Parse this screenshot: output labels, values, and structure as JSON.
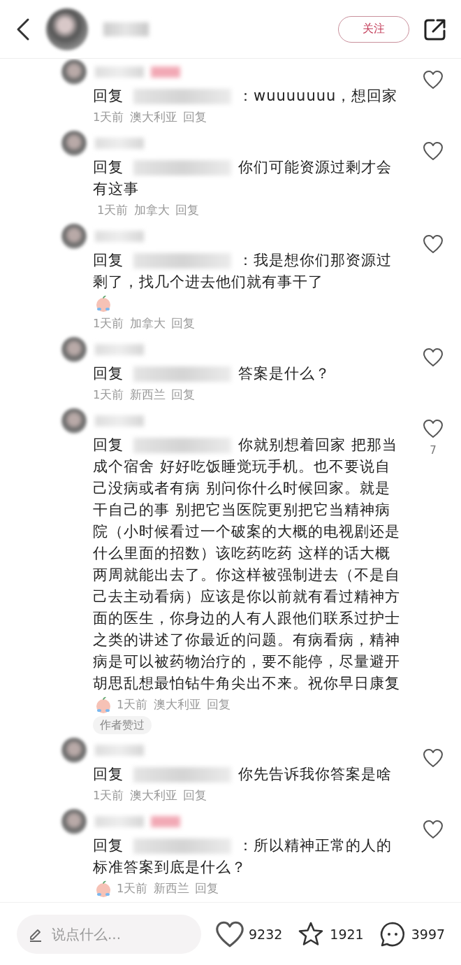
{
  "top_bar": {
    "follow_button": "关注"
  },
  "comments": [
    {
      "tagged": true,
      "reply_label": "回复",
      "text": "：wuuuuuuu，想回家",
      "emoji": false,
      "meta_own_line": true,
      "time": "1天前",
      "location": "澳大利亚",
      "reply": "回复"
    },
    {
      "tagged": false,
      "reply_label": "回复",
      "text": "你们可能资源过剩才会有这事",
      "emoji": false,
      "meta_own_line": false,
      "time": "1天前",
      "location": "加拿大",
      "reply": "回复"
    },
    {
      "tagged": false,
      "reply_label": "回复",
      "text": "：我是想你们那资源过剩了，找几个进去他们就有事干了",
      "emoji": true,
      "meta_own_line": true,
      "time": "1天前",
      "location": "加拿大",
      "reply": "回复"
    },
    {
      "tagged": false,
      "reply_label": "回复",
      "text": "答案是什么？",
      "emoji": false,
      "meta_own_line": true,
      "time": "1天前",
      "location": "新西兰",
      "reply": "回复"
    },
    {
      "tagged": false,
      "reply_label": "回复",
      "text": "你就别想着回家 把那当成个宿舍 好好吃饭睡觉玩手机。也不要说自己没病或者有病 别问你什么时候回家。就是干自己的事 别把它当医院更别把它当精神病院（小时候看过一个破案的大概的电视剧还是什么里面的招数）该吃药吃药 这样的话大概两周就能出去了。你这样被强制进去（不是自己去主动看病）应该是你以前就有看过精神方面的医生，你身边的人有人跟他们联系过护士之类的讲述了你最近的问题。有病看病，精神病是可以被药物治疗的，要不能停，尽量避开胡思乱想最怕钻牛角尖出不来。祝你早日康复",
      "emoji": true,
      "meta_own_line": false,
      "time": "1天前",
      "location": "澳大利亚",
      "reply": "回复",
      "likes": "7",
      "badge": "作者赞过"
    },
    {
      "tagged": false,
      "reply_label": "回复",
      "text": "你先告诉我你答案是啥",
      "emoji": false,
      "meta_own_line": true,
      "time": "1天前",
      "location": "澳大利亚",
      "reply": "回复"
    },
    {
      "tagged": true,
      "reply_label": "回复",
      "text": "：所以精神正常的人的标准答案到底是什么？",
      "emoji": true,
      "meta_own_line": false,
      "time": "1天前",
      "location": "新西兰",
      "reply": "回复"
    }
  ],
  "bottom_bar": {
    "placeholder": "说点什么...",
    "likes": "9232",
    "favorites": "1921",
    "comments": "3997"
  }
}
